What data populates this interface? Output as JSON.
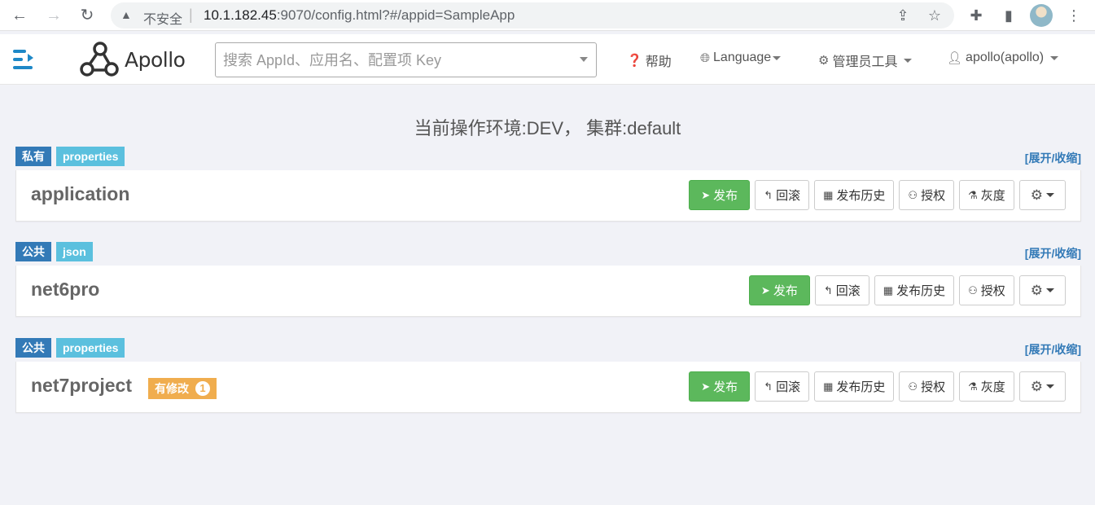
{
  "browser": {
    "security_label": "不安全",
    "url_host": "10.1.182.45",
    "url_rest": ":9070/config.html?#/appid=SampleApp"
  },
  "header": {
    "logo_text": "Apollo",
    "search_placeholder": "搜索 AppId、应用名、配置项 Key",
    "help_label": "帮助",
    "language_label": "Language",
    "admin_tools_label": "管理员工具",
    "user_label": "apollo(apollo)"
  },
  "env_title": "当前操作环境:DEV， 集群:default",
  "namespaces": [
    {
      "scope": "私有",
      "format": "properties",
      "name": "application",
      "toggle": "[展开/收缩]",
      "buttons": {
        "publish": "发布",
        "rollback": "回滚",
        "history": "发布历史",
        "grant": "授权",
        "gray": "灰度"
      }
    },
    {
      "scope": "公共",
      "format": "json",
      "name": "net6pro",
      "toggle": "[展开/收缩]",
      "buttons": {
        "publish": "发布",
        "rollback": "回滚",
        "history": "发布历史",
        "grant": "授权"
      }
    },
    {
      "scope": "公共",
      "format": "properties",
      "name": "net7project",
      "toggle": "[展开/收缩]",
      "modified_label": "有修改",
      "modified_count": "1",
      "buttons": {
        "publish": "发布",
        "rollback": "回滚",
        "history": "发布历史",
        "grant": "授权",
        "gray": "灰度"
      }
    }
  ],
  "colors": {
    "primary_blue": "#337ab7",
    "info_blue": "#5bc0de",
    "success_green": "#5cb85c",
    "warning_orange": "#f0ad4e"
  }
}
